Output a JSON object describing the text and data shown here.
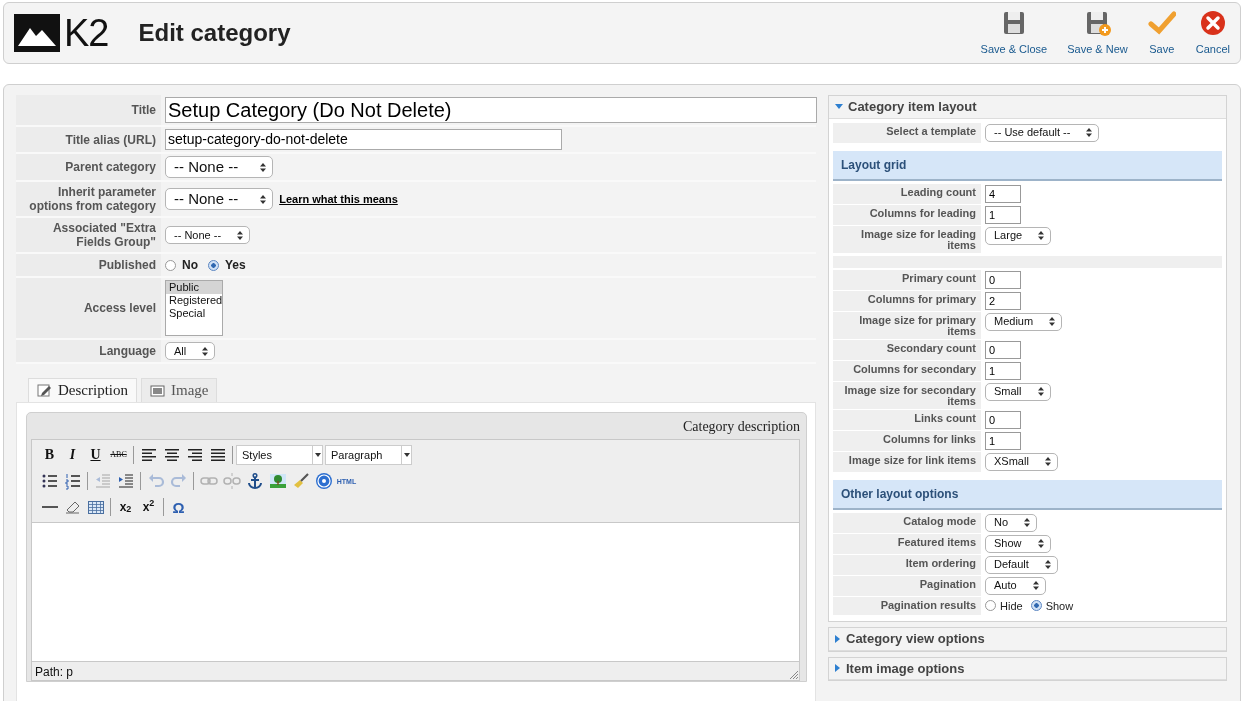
{
  "header": {
    "logo_text": "K2",
    "title": "Edit category",
    "actions": [
      {
        "kind": "save-close",
        "label": "Save & Close"
      },
      {
        "kind": "save-new",
        "label": "Save & New"
      },
      {
        "kind": "save",
        "label": "Save"
      },
      {
        "kind": "cancel",
        "label": "Cancel"
      }
    ]
  },
  "form": [
    {
      "label": "Title",
      "kind": "text-large",
      "value": "Setup Category (Do Not Delete)"
    },
    {
      "label": "Title alias (URL)",
      "kind": "text",
      "value": "setup-category-do-not-delete"
    },
    {
      "label": "Parent category",
      "kind": "select-large",
      "value": "-- None --"
    },
    {
      "label": "Inherit parameter options from category",
      "kind": "select-large",
      "value": "-- None --",
      "link": "Learn what this means"
    },
    {
      "label": "Associated \"Extra Fields Group\"",
      "kind": "select",
      "value": "-- None --"
    },
    {
      "label": "Published",
      "kind": "radio",
      "options": [
        {
          "label": "No",
          "selected": false
        },
        {
          "label": "Yes",
          "selected": true
        }
      ]
    },
    {
      "label": "Access level",
      "kind": "listbox",
      "options": [
        {
          "label": "Public",
          "selected": true
        },
        {
          "label": "Registered",
          "selected": false
        },
        {
          "label": "Special",
          "selected": false
        }
      ]
    },
    {
      "label": "Language",
      "kind": "select",
      "value": "All"
    }
  ],
  "tabs": [
    {
      "label": "Description",
      "kind": "description",
      "selected": true
    },
    {
      "label": "Image",
      "kind": "image",
      "selected": false
    }
  ],
  "editor": {
    "title": "Category description",
    "path": "Path: p",
    "toolbar": [
      [
        [
          {
            "kind": "bold",
            "glyph": "B",
            "disabled": false
          },
          {
            "kind": "italic",
            "glyph": "I",
            "disabled": false
          },
          {
            "kind": "underline",
            "glyph": "U",
            "disabled": false
          },
          {
            "kind": "strike",
            "glyph": "ABC",
            "disabled": false
          }
        ],
        [
          {
            "kind": "align-left",
            "disabled": false
          },
          {
            "kind": "align-center",
            "disabled": false
          },
          {
            "kind": "align-right",
            "disabled": false
          },
          {
            "kind": "justify",
            "disabled": false
          }
        ],
        [
          {
            "kind": "dropdown",
            "value": "Styles",
            "disabled": false
          },
          {
            "kind": "dropdown",
            "value": "Paragraph",
            "disabled": false
          }
        ]
      ],
      [
        [
          {
            "kind": "bullet-list",
            "disabled": false
          },
          {
            "kind": "numbered-list",
            "disabled": false
          }
        ],
        [
          {
            "kind": "outdent",
            "disabled": true
          },
          {
            "kind": "indent",
            "disabled": false
          }
        ],
        [
          {
            "kind": "undo",
            "disabled": true
          },
          {
            "kind": "redo",
            "disabled": true
          }
        ],
        [
          {
            "kind": "link",
            "disabled": true
          },
          {
            "kind": "unlink",
            "disabled": true
          },
          {
            "kind": "anchor",
            "disabled": false
          },
          {
            "kind": "image",
            "disabled": false
          },
          {
            "kind": "cleanup",
            "disabled": false
          },
          {
            "kind": "help",
            "disabled": false
          },
          {
            "kind": "html",
            "glyph": "HTML",
            "disabled": false
          }
        ]
      ],
      [
        [
          {
            "kind": "hr",
            "disabled": false
          },
          {
            "kind": "eraser",
            "disabled": false
          },
          {
            "kind": "table",
            "disabled": false
          }
        ],
        [
          {
            "kind": "subscript",
            "glyph": "x$_{2}$",
            "disabled": false
          },
          {
            "kind": "superscript",
            "glyph": "x$^{2}$",
            "disabled": false
          }
        ],
        [
          {
            "kind": "omega",
            "glyph": "Ω",
            "disabled": false
          }
        ]
      ]
    ]
  },
  "sidebar": {
    "panels": [
      {
        "title": "Category item layout",
        "expanded": true,
        "rows": [
          {
            "label": "Select a template",
            "kind": "select",
            "value": "-- Use default --"
          }
        ],
        "sections": [
          {
            "heading": "Layout grid",
            "rows": [
              {
                "label": "Leading count",
                "kind": "number",
                "value": "4"
              },
              {
                "label": "Columns for leading",
                "kind": "number",
                "value": "1"
              },
              {
                "label": "Image size for leading items",
                "kind": "select",
                "value": "Large"
              },
              {
                "kind": "spacer"
              },
              {
                "label": "Primary count",
                "kind": "number",
                "value": "0"
              },
              {
                "label": "Columns for primary",
                "kind": "number",
                "value": "2"
              },
              {
                "label": "Image size for primary items",
                "kind": "select",
                "value": "Medium"
              },
              {
                "label": "Secondary count",
                "kind": "number",
                "value": "0"
              },
              {
                "label": "Columns for secondary",
                "kind": "number",
                "value": "1"
              },
              {
                "label": "Image size for secondary items",
                "kind": "select",
                "value": "Small"
              },
              {
                "label": "Links count",
                "kind": "number",
                "value": "0"
              },
              {
                "label": "Columns for links",
                "kind": "number",
                "value": "1"
              },
              {
                "label": "Image size for link items",
                "kind": "select",
                "value": "XSmall"
              }
            ]
          },
          {
            "heading": "Other layout options",
            "rows": [
              {
                "label": "Catalog mode",
                "kind": "select",
                "value": "No"
              },
              {
                "label": "Featured items",
                "kind": "select",
                "value": "Show"
              },
              {
                "label": "Item ordering",
                "kind": "select",
                "value": "Default"
              },
              {
                "label": "Pagination",
                "kind": "select",
                "value": "Auto"
              },
              {
                "label": "Pagination results",
                "kind": "radio",
                "options": [
                  {
                    "label": "Hide",
                    "selected": false
                  },
                  {
                    "label": "Show",
                    "selected": true
                  }
                ]
              }
            ]
          }
        ]
      },
      {
        "title": "Category view options",
        "expanded": false
      },
      {
        "title": "Item image options",
        "expanded": false
      }
    ]
  }
}
